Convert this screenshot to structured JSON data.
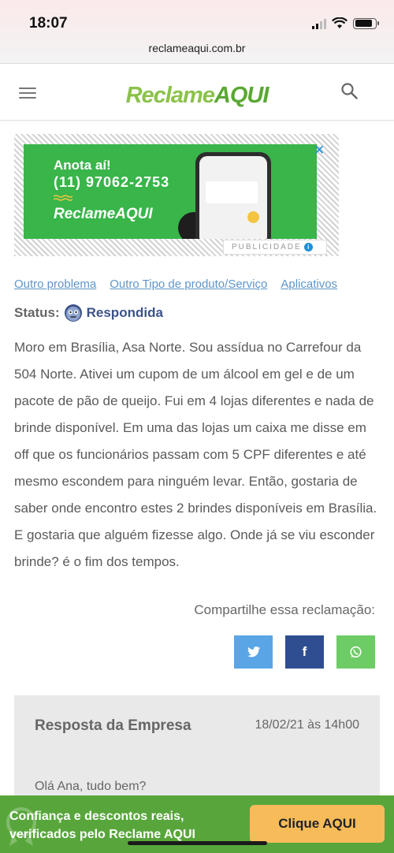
{
  "status_bar": {
    "time": "18:07",
    "url": "reclameaqui.com.br"
  },
  "header": {
    "logo_part1": "Reclame",
    "logo_part2": "AQUI"
  },
  "ad": {
    "line1": "Anota aí!",
    "phone": "(11) 97062-2753",
    "brand": "ReclameAQUI",
    "close": "✕",
    "label": "PUBLICIDADE"
  },
  "categories": [
    "Outro problema",
    "Outro Tipo de produto/Serviço",
    "Aplicativos"
  ],
  "status": {
    "label": "Status:",
    "value": "Respondida"
  },
  "complaint_text": "Moro em Brasília, Asa Norte. Sou assídua no Carrefour da 504 Norte. Ativei um cupom de um álcool em gel e de um pacote de pão de queijo. Fui em 4 lojas diferentes e nada de brinde disponível. Em uma das lojas um caixa me disse em off que os funcionários passam com 5 CPF diferentes e até mesmo escondem para ninguém levar. Então, gostaria de saber onde encontro estes 2 brindes disponíveis em Brasília. E gostaria que alguém fizesse algo. Onde já se viu esconder brinde? é o fim dos tempos.",
  "share": {
    "label": "Compartilhe essa reclamação:",
    "twitter": "𝕥",
    "facebook": "f",
    "whatsapp": "✆"
  },
  "response": {
    "title": "Resposta da Empresa",
    "date": "18/02/21 às 14h00",
    "greeting": "Olá Ana, tudo bem?"
  },
  "banner": {
    "line1": "Confiança e descontos reais,",
    "line2": "verificados pelo Reclame AQUI",
    "cta": "Clique AQUI"
  },
  "colors": {
    "brand_green": "#5aa832",
    "link_blue": "#5f95c9",
    "status_blue": "#3d5387",
    "cta": "#f7bb5a"
  }
}
